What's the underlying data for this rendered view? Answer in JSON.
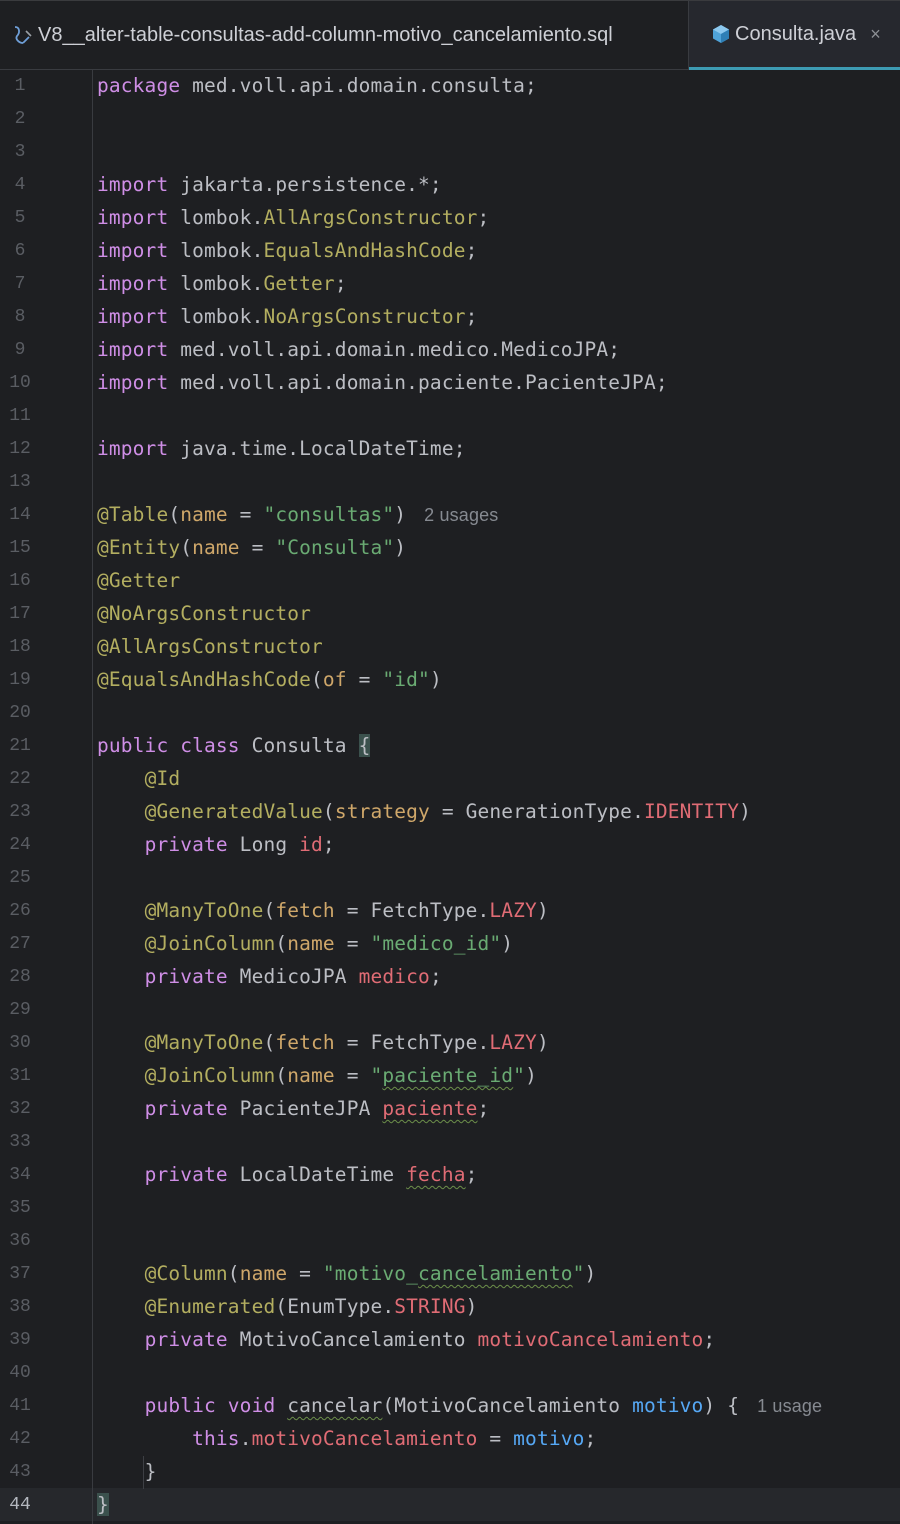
{
  "tabs": [
    {
      "label": "V8__alter-table-consultas-add-column-motivo_cancelamiento.sql",
      "icon": "sql-file-icon",
      "active": false
    },
    {
      "label": "Consulta.java",
      "icon": "java-class-icon",
      "active": true,
      "close": "×"
    }
  ],
  "editor": {
    "current_line": 44,
    "line_numbers": [
      "1",
      "2",
      "3",
      "4",
      "5",
      "6",
      "7",
      "8",
      "9",
      "10",
      "11",
      "12",
      "13",
      "14",
      "15",
      "16",
      "17",
      "18",
      "19",
      "20",
      "21",
      "22",
      "23",
      "24",
      "25",
      "26",
      "27",
      "28",
      "29",
      "30",
      "31",
      "32",
      "33",
      "34",
      "35",
      "36",
      "37",
      "38",
      "39",
      "40",
      "41",
      "42",
      "43",
      "44"
    ],
    "lines": {
      "l1": [
        "package",
        " med.voll.api.domain.consulta;"
      ],
      "l4": [
        "import",
        " jakarta.persistence.*;"
      ],
      "l5": [
        "import",
        " lombok.",
        "AllArgsConstructor",
        ";"
      ],
      "l6": [
        "import",
        " lombok.",
        "EqualsAndHashCode",
        ";"
      ],
      "l7": [
        "import",
        " lombok.",
        "Getter",
        ";"
      ],
      "l8": [
        "import",
        " lombok.",
        "NoArgsConstructor",
        ";"
      ],
      "l9": [
        "import",
        " med.voll.api.domain.medico.MedicoJPA;"
      ],
      "l10": [
        "import",
        " med.voll.api.domain.paciente.PacienteJPA;"
      ],
      "l12": [
        "import",
        " java.time.LocalDateTime;"
      ],
      "l14": [
        "@Table",
        "(",
        "name",
        " = ",
        "\"consultas\"",
        ")",
        "2 usages"
      ],
      "l15": [
        "@Entity",
        "(",
        "name",
        " = ",
        "\"Consulta\"",
        ")"
      ],
      "l16": [
        "@Getter"
      ],
      "l17": [
        "@NoArgsConstructor"
      ],
      "l18": [
        "@AllArgsConstructor"
      ],
      "l19": [
        "@EqualsAndHashCode",
        "(",
        "of",
        " = ",
        "\"id\"",
        ")"
      ],
      "l21": [
        "public",
        " ",
        "class",
        " Consulta ",
        "{"
      ],
      "l22": [
        "@Id"
      ],
      "l23": [
        "@GeneratedValue",
        "(",
        "strategy",
        " = GenerationType.",
        "IDENTITY",
        ")"
      ],
      "l24": [
        "private",
        " Long ",
        "id",
        ";"
      ],
      "l26": [
        "@ManyToOne",
        "(",
        "fetch",
        " = FetchType.",
        "LAZY",
        ")"
      ],
      "l27": [
        "@JoinColumn",
        "(",
        "name",
        " = ",
        "\"medico_id\"",
        ")"
      ],
      "l28": [
        "private",
        " MedicoJPA ",
        "medico",
        ";"
      ],
      "l30": [
        "@ManyToOne",
        "(",
        "fetch",
        " = FetchType.",
        "LAZY",
        ")"
      ],
      "l31": [
        "@JoinColumn",
        "(",
        "name",
        " = ",
        "\"",
        "paciente_id",
        "\"",
        ")"
      ],
      "l32": [
        "private",
        " PacienteJPA ",
        "paciente",
        ";"
      ],
      "l34": [
        "private",
        " LocalDateTime ",
        "fecha",
        ";"
      ],
      "l37": [
        "@Column",
        "(",
        "name",
        " = ",
        "\"motivo_",
        "cancelamiento",
        "\"",
        ")"
      ],
      "l38": [
        "@Enumerated",
        "(EnumType.",
        "STRING",
        ")"
      ],
      "l39": [
        "private",
        " MotivoCancelamiento ",
        "motivoCancelamiento",
        ";"
      ],
      "l41": [
        "public",
        " ",
        "void",
        " ",
        "cancelar",
        "(MotivoCancelamiento ",
        "motivo",
        ") {",
        "1 usage"
      ],
      "l42": [
        "this",
        ".",
        "motivoCancelamiento",
        " = ",
        "motivo",
        ";"
      ],
      "l43": [
        "}"
      ],
      "l44": [
        "}"
      ]
    }
  },
  "colors": {
    "background": "#1e1f22",
    "keyword": "#cf8ee6",
    "annotation": "#b3ae60",
    "string": "#6aab73",
    "field": "#c77dbb",
    "parameter": "#56a8f5",
    "active_tab_underline": "#3d9bb3"
  }
}
